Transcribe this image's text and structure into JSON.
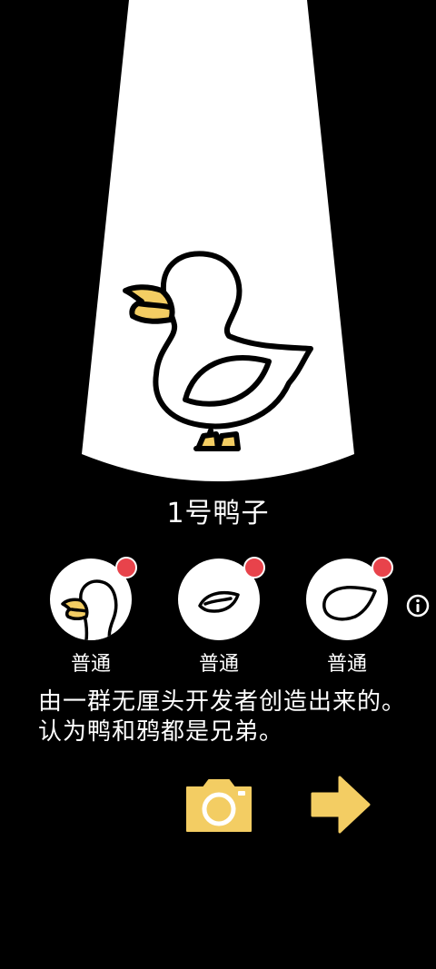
{
  "duck": {
    "name": "1号鸭子"
  },
  "parts": [
    {
      "icon": "duck-head-icon",
      "rarity": "普通",
      "badge": "new"
    },
    {
      "icon": "duck-wing-icon",
      "rarity": "普通",
      "badge": "new"
    },
    {
      "icon": "duck-body-icon",
      "rarity": "普通",
      "badge": "new"
    }
  ],
  "description": "由一群无厘头开发者创造出来的。 认为鸭和鸦都是兄弟。",
  "controls": {
    "info": "info-icon",
    "camera": "camera-icon",
    "next": "arrow-right-icon"
  },
  "colors": {
    "background": "#000000",
    "spotlight": "#ffffff",
    "accent": "#f3cd63",
    "badge": "#e8434b"
  }
}
